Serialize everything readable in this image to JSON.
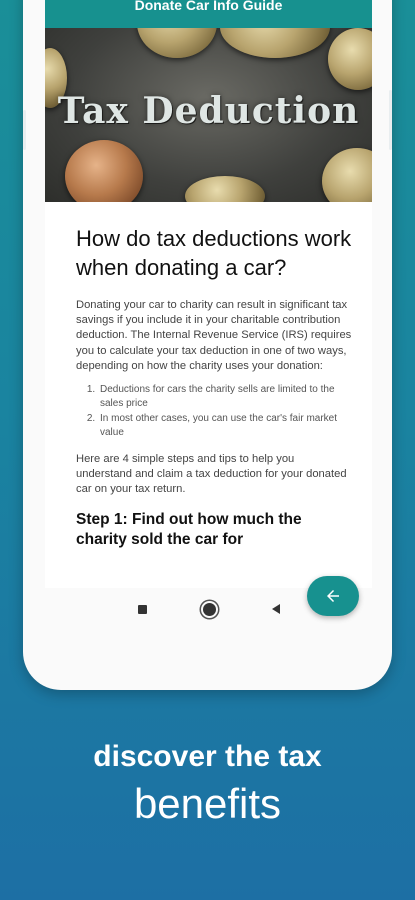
{
  "app": {
    "bar_title": "Donate Car Info Guide"
  },
  "hero": {
    "image_text": "Tax Deduction"
  },
  "article": {
    "title": "How do tax deductions work when donating a car?",
    "intro": "Donating your car to charity can result in significant tax savings if you include it in your charitable contribution deduction. The Internal Revenue Service (IRS) requires you to calculate your tax deduction in one of two ways, depending on how the charity uses your donation:",
    "list": [
      "Deductions for cars the charity sells are limited to the sales price",
      "In most other cases, you can use the car's fair market value"
    ],
    "steps_intro": "Here are 4 simple steps and tips to help you understand and claim a tax deduction for your donated car on your tax return.",
    "step1": "Step 1: Find out how much the charity sold the car for"
  },
  "fab": {
    "icon": "arrow-left-icon"
  },
  "navbar": {
    "icons": [
      "square-recents-icon",
      "circle-home-icon",
      "triangle-back-icon"
    ]
  },
  "caption": {
    "line1": "discover the tax",
    "line2": "benefits"
  },
  "colors": {
    "accent": "#17918f",
    "background_top": "#1a8f98",
    "background_bottom": "#1d6fa4"
  }
}
